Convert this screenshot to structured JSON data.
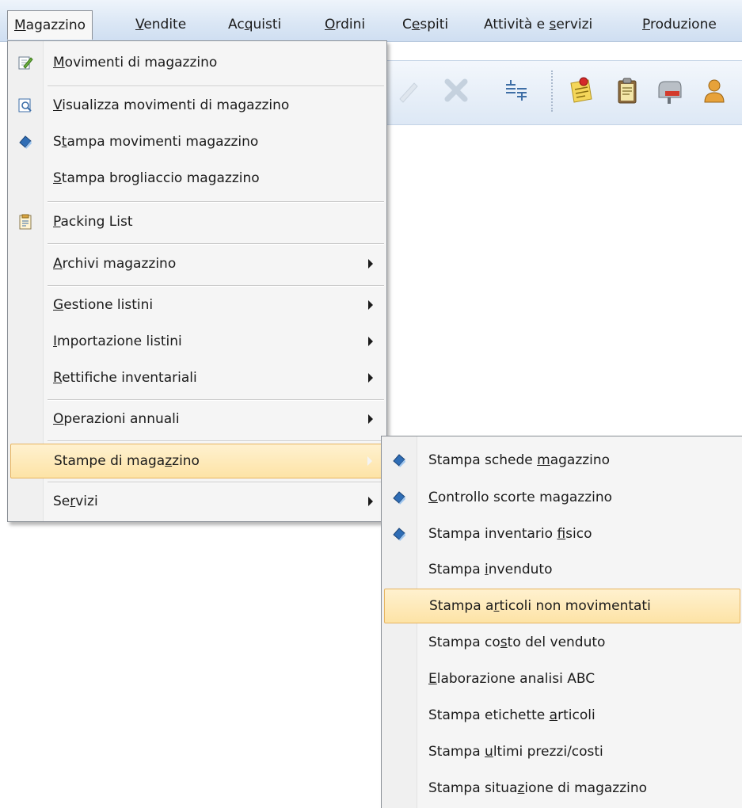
{
  "menubar": [
    {
      "pre": "",
      "key": "M",
      "post": "agazzino",
      "active": true
    },
    {
      "pre": "",
      "key": "V",
      "post": "endite"
    },
    {
      "pre": "Ac",
      "key": "q",
      "post": "uisti"
    },
    {
      "pre": "",
      "key": "O",
      "post": "rdini"
    },
    {
      "pre": "C",
      "key": "e",
      "post": "spiti"
    },
    {
      "pre": "Attività e ",
      "key": "s",
      "post": "ervizi"
    },
    {
      "pre": "",
      "key": "P",
      "post": "roduzione"
    }
  ],
  "toolbar": {
    "icons": [
      "pencil-icon",
      "delete-x-icon",
      "align-icon",
      "sticky-note-pin-icon",
      "clipboard-icon",
      "mailbox-icon",
      "user-icon"
    ]
  },
  "main_menu": {
    "items": [
      {
        "pre": "",
        "key": "M",
        "post": "ovimenti di magazzino",
        "icon": "edit-document-icon"
      },
      {
        "pre": "",
        "key": "V",
        "post": "isualizza movimenti di magazzino",
        "icon": "view-document-icon"
      },
      {
        "pre": "S",
        "key": "t",
        "post": "ampa movimenti magazzino",
        "icon": "print-icon"
      },
      {
        "pre": "",
        "key": "S",
        "post": "tampa brogliaccio magazzino",
        "icon": ""
      },
      {
        "pre": "",
        "key": "P",
        "post": "acking List",
        "icon": "packing-list-icon"
      },
      {
        "pre": "",
        "key": "A",
        "post": "rchivi magazzino",
        "submenu": true
      },
      {
        "pre": "",
        "key": "G",
        "post": "estione listini",
        "submenu": true
      },
      {
        "pre": "",
        "key": "I",
        "post": "mportazione listini",
        "submenu": true
      },
      {
        "pre": "",
        "key": "R",
        "post": "ettifiche inventariali",
        "submenu": true
      },
      {
        "pre": "",
        "key": "O",
        "post": "perazioni annuali",
        "submenu": true
      },
      {
        "pre": "Stampe di maga",
        "key": "z",
        "post": "zino",
        "submenu": true,
        "highlighted": true
      },
      {
        "pre": "Se",
        "key": "r",
        "post": "vizi",
        "submenu": true
      }
    ]
  },
  "sub_menu": {
    "items": [
      {
        "pre": "Stampa schede ",
        "key": "m",
        "post": "agazzino",
        "icon": "print-icon"
      },
      {
        "pre": "",
        "key": "C",
        "post": "ontrollo scorte magazzino",
        "icon": "print-icon"
      },
      {
        "pre": "Stampa inventario ",
        "key": "f",
        "post": "isico",
        "icon": "print-icon"
      },
      {
        "pre": "Stampa ",
        "key": "i",
        "post": "nvenduto"
      },
      {
        "pre": "Stampa a",
        "key": "r",
        "post": "ticoli non movimentati",
        "highlighted": true
      },
      {
        "pre": "Stampa co",
        "key": "s",
        "post": "to del venduto"
      },
      {
        "pre": "",
        "key": "E",
        "post": "laborazione analisi ABC"
      },
      {
        "pre": "Stampa etichette ",
        "key": "a",
        "post": "rticoli"
      },
      {
        "pre": "Stampa ",
        "key": "u",
        "post": "ltimi prezzi/costi"
      },
      {
        "pre": "Stampa situa",
        "key": "z",
        "post": "ione di magazzino"
      }
    ]
  },
  "colors": {
    "menubar_bg": "#dbe7f5",
    "menu_bg": "#f5f5f5",
    "highlight_bg": "#fde3a6",
    "highlight_border": "#e7b45f",
    "print_icon": "#2f6db5"
  }
}
